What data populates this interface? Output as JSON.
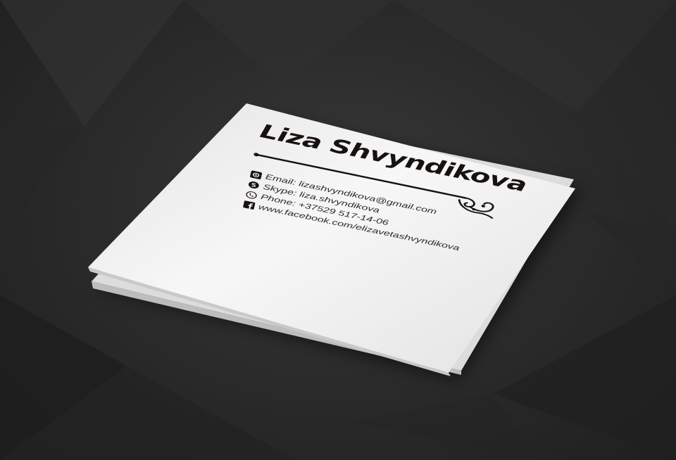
{
  "card": {
    "name": "Liza Shvyndikova",
    "contacts": [
      {
        "icon": "email-icon",
        "text": "Email: lizashvyndikova@gmail.com"
      },
      {
        "icon": "skype-icon",
        "text": "Skype: liza.shvyndikova"
      },
      {
        "icon": "phone-icon",
        "text": "Phone: +37529 517-14-06"
      },
      {
        "icon": "facebook-icon",
        "text": "www.facebook.com/elizavetashvyndikova"
      }
    ]
  },
  "colors": {
    "background": "#2b2b2b",
    "card": "#f2f2f2",
    "ink": "#17120f"
  }
}
